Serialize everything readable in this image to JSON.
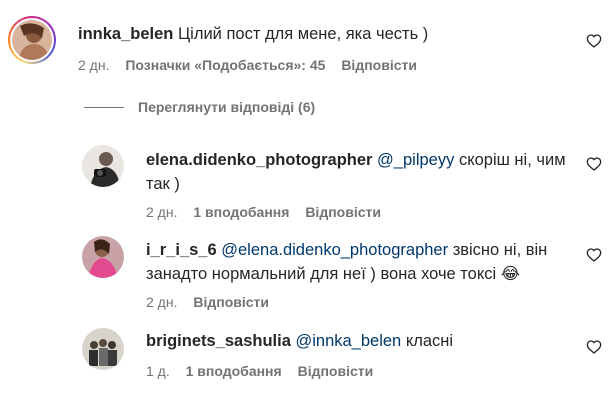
{
  "comments": [
    {
      "username": "innka_belen",
      "text": "Цілий пост для мене, яка честь )",
      "time": "2 дн.",
      "likes": "Позначки «Подобається»: 45",
      "reply": "Відповісти"
    }
  ],
  "view_replies": "Переглянути відповіді (6)",
  "replies": [
    {
      "username": "elena.didenko_photographer",
      "mention": "@_pilpeyy",
      "text": "скоріш ні, чим так )",
      "time": "2 дн.",
      "likes": "1 вподобання",
      "reply": "Відповісти"
    },
    {
      "username": "i_r_i_s_6",
      "mention": "@elena.didenko_photographer",
      "text": "звісно ні, він занадто нормальний для неї ) вона хоче токсі 😂",
      "time": "2 дн.",
      "reply": "Відповісти"
    },
    {
      "username": "briginets_sashulia",
      "mention": "@innka_belen",
      "text": "класні",
      "time": "1 д.",
      "likes": "1 вподобання",
      "reply": "Відповісти"
    }
  ],
  "colors": {
    "text": "#262626",
    "muted": "#737373",
    "mention": "#00376b"
  },
  "icons": {
    "like": "heart-outline-icon"
  }
}
